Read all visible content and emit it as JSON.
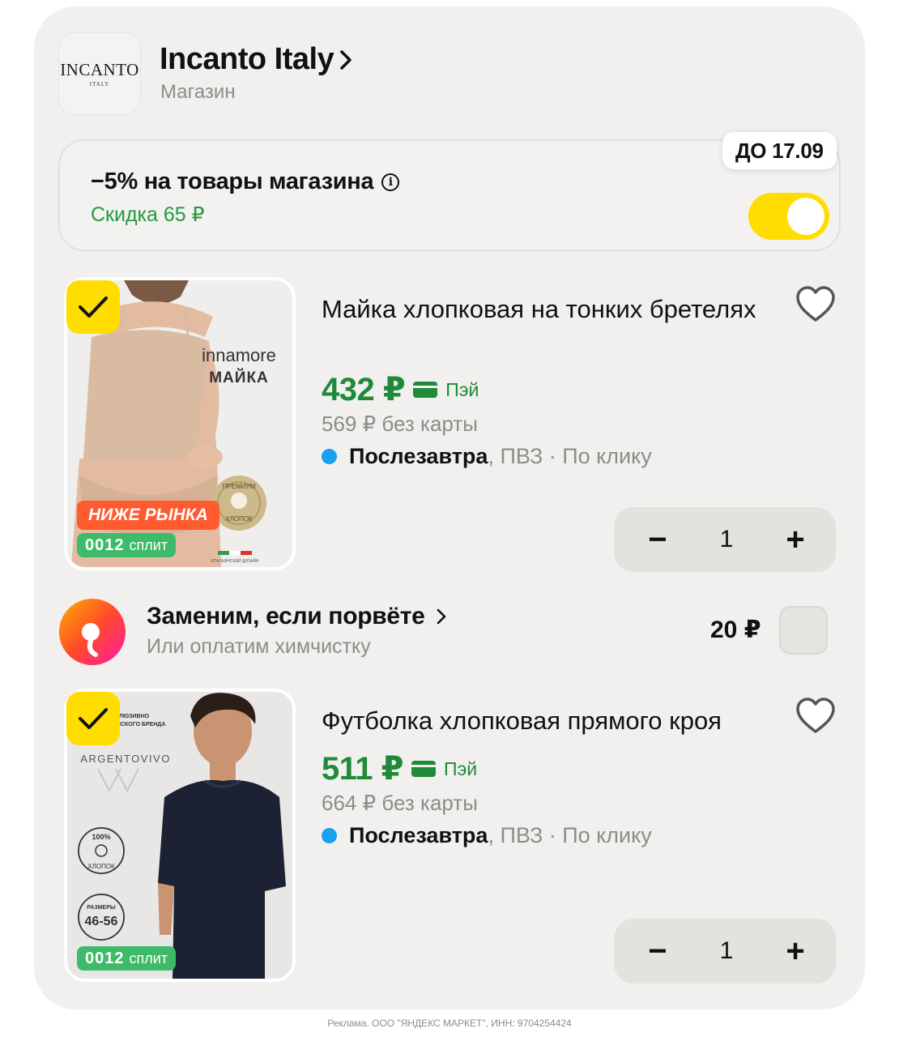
{
  "shop": {
    "logo_main": "INCANTO",
    "logo_sub": "ITALY",
    "name": "Incanto Italy",
    "type": "Магазин"
  },
  "promo": {
    "title": "−5% на товары магазина",
    "discount": "Скидка 65 ₽",
    "deadline": "ДО 17.09",
    "toggle_on": true,
    "accent": "#ffdd00"
  },
  "products": [
    {
      "title": "Майка хлопковая на тонких бретелях",
      "price": "432 ₽",
      "pay_label": "Пэй",
      "old_price": "569 ₽ без карты",
      "delivery_day": "Послезавтра",
      "delivery_rest": ", ПВЗ · По клику",
      "quantity": "1",
      "selected": true,
      "image": {
        "brand": "innamore",
        "kind": "МАЙКА",
        "badge": "НИЖЕ РЫНКА",
        "split_num": "0012",
        "split_label": "сплит",
        "seal_top": "ПРЕМИУМ",
        "seal_bottom": "ХЛОПОК",
        "footnote": "ИТАЛЬЯНСКИЙ ДИЗАЙН"
      }
    },
    {
      "title": "Футболка хлопковая прямого кроя",
      "price": "511 ₽",
      "pay_label": "Пэй",
      "old_price": "664 ₽ без карты",
      "delivery_day": "Послезавтра",
      "delivery_rest": ", ПВЗ · По клику",
      "quantity": "1",
      "selected": true,
      "image": {
        "tagline_1": "ЛЮЗИВНО",
        "tagline_2": "ІСКОГО БРЕНДА",
        "brand": "ARGENTOVIVO",
        "cotton_pct": "100%",
        "cotton_label": "ХЛОПОК",
        "sizes_label": "РАЗМЕРЫ",
        "sizes": "46-56",
        "split_num": "0012",
        "split_label": "сплит"
      }
    }
  ],
  "insurance": {
    "title": "Заменим, если порвёте",
    "subtitle": "Или оплатим химчистку",
    "price": "20 ₽",
    "checked": false
  },
  "footer": "Реклама. ООО \"ЯНДЕКС МАРКЕТ\", ИНН: 9704254424",
  "icons": {
    "chevron": "chevron-right-icon",
    "info": "info-icon",
    "heart": "heart-icon",
    "check": "checkmark-icon",
    "minus": "−",
    "plus": "+"
  }
}
